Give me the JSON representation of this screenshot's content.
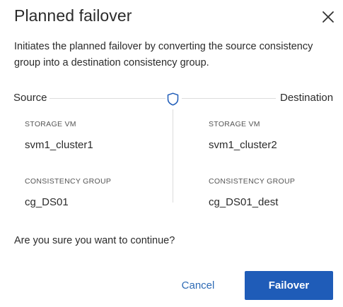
{
  "dialog": {
    "title": "Planned failover",
    "description": "Initiates the planned failover by converting the source consistency group into a destination consistency group.",
    "relationship": {
      "source_label": "Source",
      "destination_label": "Destination",
      "icon": "shield-icon"
    },
    "source": {
      "storage_vm_label": "STORAGE VM",
      "storage_vm_value": "svm1_cluster1",
      "consistency_group_label": "CONSISTENCY GROUP",
      "consistency_group_value": "cg_DS01"
    },
    "destination": {
      "storage_vm_label": "STORAGE VM",
      "storage_vm_value": "svm1_cluster2",
      "consistency_group_label": "CONSISTENCY GROUP",
      "consistency_group_value": "cg_DS01_dest"
    },
    "confirm_text": "Are you sure you want to continue?",
    "buttons": {
      "cancel_label": "Cancel",
      "primary_label": "Failover"
    }
  },
  "colors": {
    "primary": "#1f5cb8",
    "link": "#2e6bb5",
    "divider": "#dcdcdc"
  }
}
